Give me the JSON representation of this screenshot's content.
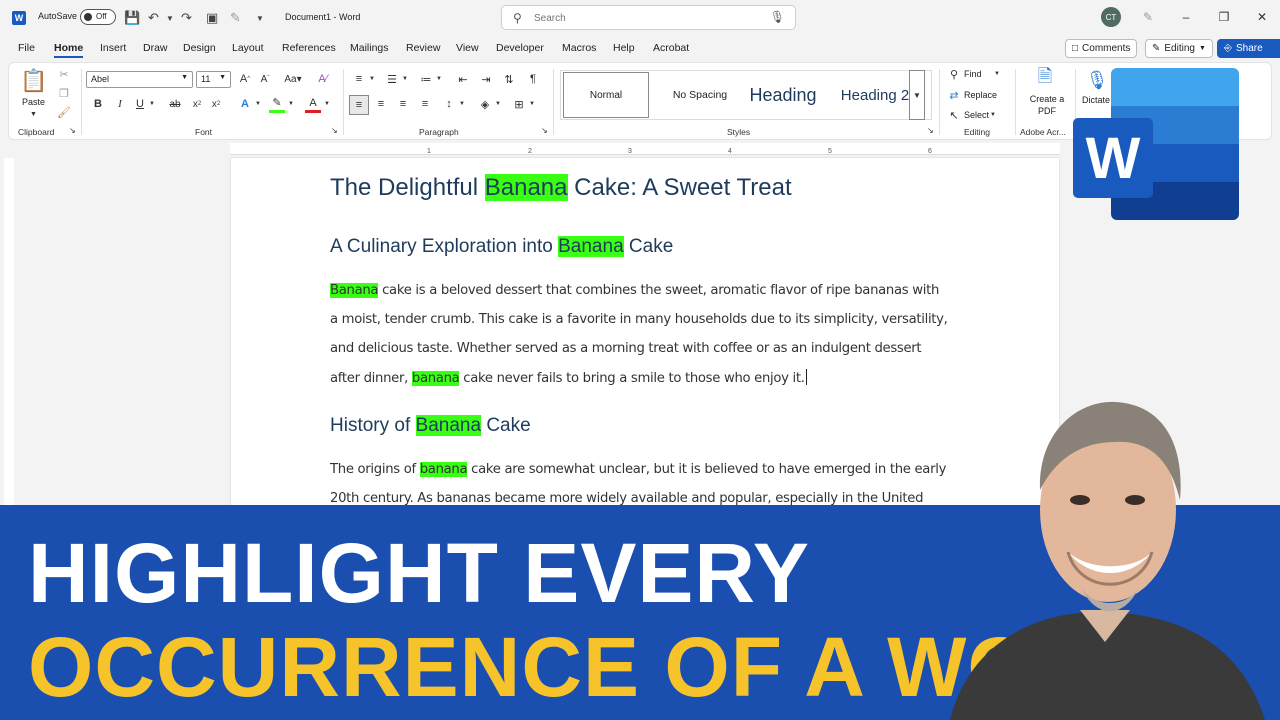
{
  "titlebar": {
    "app_icon": "word-icon",
    "autosave_label": "AutoSave",
    "autosave_state": "Off",
    "document_title": "Document1  -  Word",
    "search_placeholder": "Search",
    "avatar_initials": "CT"
  },
  "menu": {
    "tabs": [
      "File",
      "Home",
      "Insert",
      "Draw",
      "Design",
      "Layout",
      "References",
      "Mailings",
      "Review",
      "View",
      "Developer",
      "Macros",
      "Help",
      "Acrobat"
    ],
    "active_tab": "Home",
    "comments_label": "Comments",
    "editing_label": "Editing",
    "share_label": "Share"
  },
  "ribbon": {
    "clipboard": {
      "paste_label": "Paste",
      "group_label": "Clipboard"
    },
    "font": {
      "font_name": "Abel",
      "font_size": "11",
      "group_label": "Font"
    },
    "paragraph": {
      "group_label": "Paragraph"
    },
    "styles": {
      "items": [
        "Normal",
        "No Spacing",
        "Heading",
        "Heading 2"
      ],
      "group_label": "Styles"
    },
    "editing": {
      "find_label": "Find",
      "replace_label": "Replace",
      "select_label": "Select",
      "group_label": "Editing"
    },
    "adobe": {
      "create_pdf_label": "Create a PDF",
      "group_label": "Adobe Acr..."
    },
    "dictate_label": "Dictate",
    "partial_label": "ot"
  },
  "document": {
    "h1_before": "The Delightful ",
    "h1_highlight": "Banana",
    "h1_after": " Cake: A Sweet Treat",
    "h2a_before": "A Culinary Exploration into ",
    "h2a_highlight": "Banana",
    "h2a_after": " Cake",
    "p1_highlight": "Banana",
    "p1_a": " cake is a beloved dessert that combines the sweet, aromatic flavor of ripe bananas with a moist, tender crumb. This cake is a favorite in many households due to its simplicity, versatility, and delicious taste. Whether served as a morning treat with coffee or as an indulgent dessert after dinner, ",
    "p1_highlight2": "banana",
    "p1_b": " cake never fails to bring a smile to those who enjoy it.",
    "h2b_before": "History of ",
    "h2b_highlight": "Banana",
    "h2b_after": " Cake",
    "p2_before": "The origins of ",
    "p2_highlight": "banana",
    "p2_after": " cake are somewhat unclear, but it is believed to have emerged in the early 20th century. As bananas became more widely available and popular, especially in the United States, bakers"
  },
  "banner": {
    "line1": "HIGHLIGHT EVERY",
    "line2": "OCCURRENCE OF A WORD"
  },
  "logo": {
    "letter": "W"
  },
  "colors": {
    "accent": "#185abd",
    "highlight": "#39ff14",
    "banner_bg": "#1a4fb0",
    "banner_yellow": "#f6c32a"
  }
}
